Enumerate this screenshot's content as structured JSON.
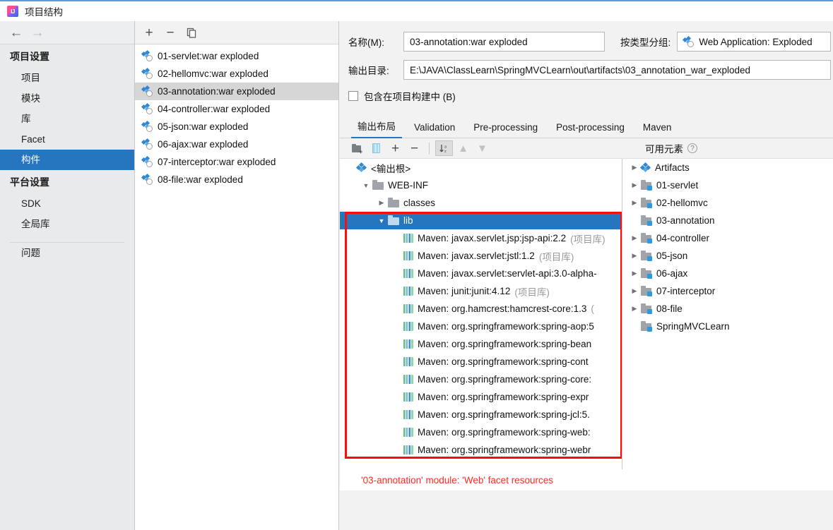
{
  "window": {
    "title": "项目结构",
    "app_icon": "intellij-idea-icon"
  },
  "sidebar": {
    "back_icon": "arrow-left-icon",
    "forward_icon": "arrow-right-icon",
    "groups": [
      {
        "title": "项目设置",
        "items": [
          {
            "label": "项目",
            "selected": false
          },
          {
            "label": "模块",
            "selected": false
          },
          {
            "label": "库",
            "selected": false
          },
          {
            "label": "Facet",
            "selected": false
          },
          {
            "label": "构件",
            "selected": true
          }
        ]
      },
      {
        "title": "平台设置",
        "items": [
          {
            "label": "SDK",
            "selected": false
          },
          {
            "label": "全局库",
            "selected": false
          }
        ]
      }
    ],
    "problems_label": "问题",
    "selected_color": "#2675bf"
  },
  "artifacts_panel": {
    "toolbar": {
      "add_label": "+",
      "remove_label": "−",
      "copy_icon": "copy-icon"
    },
    "items": [
      {
        "label": "01-servlet:war exploded",
        "selected": false
      },
      {
        "label": "02-hellomvc:war exploded",
        "selected": false
      },
      {
        "label": "03-annotation:war exploded",
        "selected": true
      },
      {
        "label": "04-controller:war exploded",
        "selected": false
      },
      {
        "label": "05-json:war exploded",
        "selected": false
      },
      {
        "label": "06-ajax:war exploded",
        "selected": false
      },
      {
        "label": "07-interceptor:war exploded",
        "selected": false
      },
      {
        "label": "08-file:war exploded",
        "selected": false
      }
    ]
  },
  "details": {
    "name_label": "名称(M):",
    "name_mnemonic": "M",
    "name_value": "03-annotation:war exploded",
    "group_label": "按类型分组:",
    "group_value": "Web Application: Exploded",
    "outdir_label": "输出目录:",
    "outdir_value": "E:\\JAVA\\ClassLearn\\SpringMVCLearn\\out\\artifacts\\03_annotation_war_exploded",
    "include_build_label": "包含在项目构建中 (B)",
    "include_build_checked": false
  },
  "tabs": [
    {
      "label": "输出布局",
      "active": true
    },
    {
      "label": "Validation",
      "active": false
    },
    {
      "label": "Pre-processing",
      "active": false
    },
    {
      "label": "Post-processing",
      "active": false
    },
    {
      "label": "Maven",
      "active": false
    }
  ],
  "tree_toolbar": {
    "create_dir_icon": "folder-plus-icon",
    "create_archive_icon": "jar-archive-icon",
    "add_label": "+",
    "remove_label": "−",
    "sort_icon": "sort-a-z-icon",
    "move_up_icon": "arrow-up-icon",
    "move_down_icon": "arrow-down-icon",
    "available_label": "可用元素",
    "help_icon": "help-circle-icon"
  },
  "output_tree": [
    {
      "depth": 0,
      "twisty": "none",
      "icon": "artifact-root-icon",
      "label": "<输出根>",
      "note": "",
      "selected": false
    },
    {
      "depth": 1,
      "twisty": "expanded",
      "icon": "folder-icon",
      "label": "WEB-INF",
      "note": "",
      "selected": false
    },
    {
      "depth": 2,
      "twisty": "collapsed",
      "icon": "folder-icon",
      "label": "classes",
      "note": "",
      "selected": false
    },
    {
      "depth": 2,
      "twisty": "expanded",
      "icon": "folder-icon",
      "label": "lib",
      "note": "",
      "selected": true
    },
    {
      "depth": 3,
      "twisty": "none",
      "icon": "library-icon",
      "label": "Maven: javax.servlet.jsp:jsp-api:2.2",
      "note": "(项目库)",
      "selected": false
    },
    {
      "depth": 3,
      "twisty": "none",
      "icon": "library-icon",
      "label": "Maven: javax.servlet:jstl:1.2",
      "note": "(项目库)",
      "selected": false
    },
    {
      "depth": 3,
      "twisty": "none",
      "icon": "library-icon",
      "label": "Maven: javax.servlet:servlet-api:3.0-alpha-",
      "note": "",
      "selected": false
    },
    {
      "depth": 3,
      "twisty": "none",
      "icon": "library-icon",
      "label": "Maven: junit:junit:4.12",
      "note": "(项目库)",
      "selected": false
    },
    {
      "depth": 3,
      "twisty": "none",
      "icon": "library-icon",
      "label": "Maven: org.hamcrest:hamcrest-core:1.3",
      "note": "(",
      "selected": false
    },
    {
      "depth": 3,
      "twisty": "none",
      "icon": "library-icon",
      "label": "Maven: org.springframework:spring-aop:5",
      "note": "",
      "selected": false
    },
    {
      "depth": 3,
      "twisty": "none",
      "icon": "library-icon",
      "label": "Maven: org.springframework:spring-bean",
      "note": "",
      "selected": false
    },
    {
      "depth": 3,
      "twisty": "none",
      "icon": "library-icon",
      "label": "Maven: org.springframework:spring-cont",
      "note": "",
      "selected": false
    },
    {
      "depth": 3,
      "twisty": "none",
      "icon": "library-icon",
      "label": "Maven: org.springframework:spring-core:",
      "note": "",
      "selected": false
    },
    {
      "depth": 3,
      "twisty": "none",
      "icon": "library-icon",
      "label": "Maven: org.springframework:spring-expr",
      "note": "",
      "selected": false
    },
    {
      "depth": 3,
      "twisty": "none",
      "icon": "library-icon",
      "label": "Maven: org.springframework:spring-jcl:5.",
      "note": "",
      "selected": false
    },
    {
      "depth": 3,
      "twisty": "none",
      "icon": "library-icon",
      "label": "Maven: org.springframework:spring-web:",
      "note": "",
      "selected": false
    },
    {
      "depth": 3,
      "twisty": "none",
      "icon": "library-icon",
      "label": "Maven: org.springframework:spring-webr",
      "note": "",
      "selected": false
    }
  ],
  "available_tree": [
    {
      "twisty": "collapsed",
      "icon": "artifact-root-icon",
      "label": "Artifacts"
    },
    {
      "twisty": "collapsed",
      "icon": "module-icon",
      "label": "01-servlet"
    },
    {
      "twisty": "collapsed",
      "icon": "module-icon",
      "label": "02-hellomvc"
    },
    {
      "twisty": "none",
      "icon": "module-icon",
      "label": "03-annotation"
    },
    {
      "twisty": "collapsed",
      "icon": "module-icon",
      "label": "04-controller"
    },
    {
      "twisty": "collapsed",
      "icon": "module-icon",
      "label": "05-json"
    },
    {
      "twisty": "collapsed",
      "icon": "module-icon",
      "label": "06-ajax"
    },
    {
      "twisty": "collapsed",
      "icon": "module-icon",
      "label": "07-interceptor"
    },
    {
      "twisty": "collapsed",
      "icon": "module-icon",
      "label": "08-file"
    },
    {
      "twisty": "none",
      "icon": "module-icon",
      "label": "SpringMVCLearn"
    }
  ],
  "status": {
    "message": "'03-annotation' module: 'Web' facet resources",
    "color": "#ff2a1f"
  },
  "annotation": {
    "highlight_color": "#fb0d0d"
  }
}
